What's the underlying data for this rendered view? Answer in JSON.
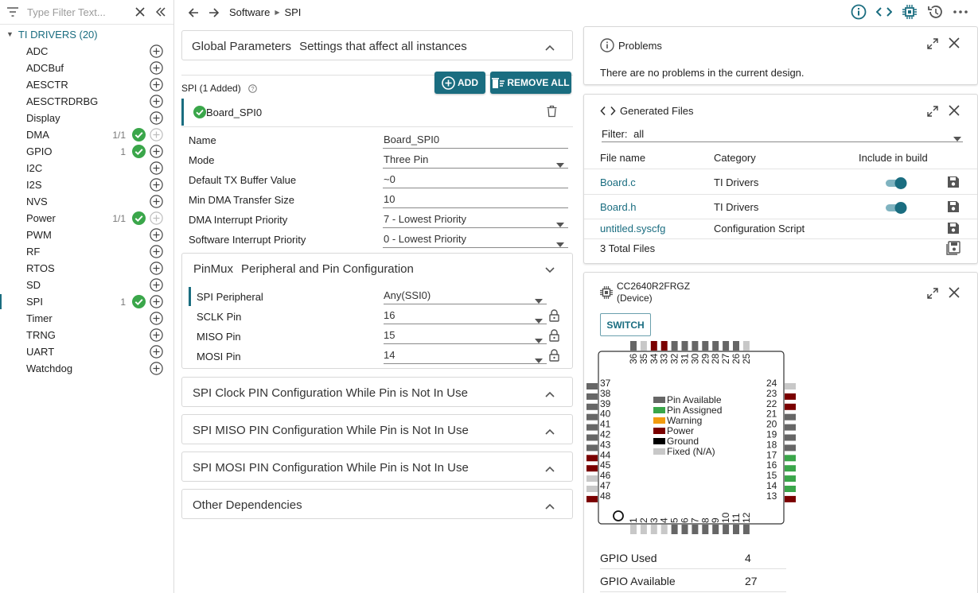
{
  "sidebar": {
    "filter_placeholder": "Type Filter Text...",
    "group_label": "TI DRIVERS (20)",
    "items": [
      {
        "label": "ADC",
        "count": "",
        "status": ""
      },
      {
        "label": "ADCBuf",
        "count": "",
        "status": ""
      },
      {
        "label": "AESCTR",
        "count": "",
        "status": ""
      },
      {
        "label": "AESCTRDRBG",
        "count": "",
        "status": ""
      },
      {
        "label": "Display",
        "count": "",
        "status": ""
      },
      {
        "label": "DMA",
        "count": "1/1",
        "status": "ok"
      },
      {
        "label": "GPIO",
        "count": "1",
        "status": "ok"
      },
      {
        "label": "I2C",
        "count": "",
        "status": ""
      },
      {
        "label": "I2S",
        "count": "",
        "status": ""
      },
      {
        "label": "NVS",
        "count": "",
        "status": ""
      },
      {
        "label": "Power",
        "count": "1/1",
        "status": "ok"
      },
      {
        "label": "PWM",
        "count": "",
        "status": ""
      },
      {
        "label": "RF",
        "count": "",
        "status": ""
      },
      {
        "label": "RTOS",
        "count": "",
        "status": ""
      },
      {
        "label": "SD",
        "count": "",
        "status": ""
      },
      {
        "label": "SPI",
        "count": "1",
        "status": "ok"
      },
      {
        "label": "Timer",
        "count": "",
        "status": ""
      },
      {
        "label": "TRNG",
        "count": "",
        "status": ""
      },
      {
        "label": "UART",
        "count": "",
        "status": ""
      },
      {
        "label": "Watchdog",
        "count": "",
        "status": ""
      }
    ]
  },
  "breadcrumb": {
    "root": "Software",
    "current": "SPI"
  },
  "global": {
    "title": "Global Parameters",
    "subtitle": "Settings that affect all instances"
  },
  "spi": {
    "header": "SPI (1 Added)",
    "add_label": "ADD",
    "remove_all_label": "REMOVE ALL",
    "instance_name": "Board_SPI0"
  },
  "fields": [
    {
      "label": "Name",
      "value": "Board_SPI0",
      "dropdown": false
    },
    {
      "label": "Mode",
      "value": "Three Pin",
      "dropdown": true
    },
    {
      "label": "Default TX Buffer Value",
      "value": "~0",
      "dropdown": false
    },
    {
      "label": "Min DMA Transfer Size",
      "value": "10",
      "dropdown": false
    },
    {
      "label": "DMA Interrupt Priority",
      "value": "7 - Lowest Priority",
      "dropdown": true
    },
    {
      "label": "Software Interrupt Priority",
      "value": "0 - Lowest Priority",
      "dropdown": true
    }
  ],
  "pinmux": {
    "title": "PinMux",
    "subtitle": "Peripheral and Pin Configuration",
    "rows": [
      {
        "label": "SPI Peripheral",
        "value": "Any(SSI0)",
        "lock": false
      },
      {
        "label": "SCLK Pin",
        "value": "16",
        "lock": true
      },
      {
        "label": "MISO Pin",
        "value": "15",
        "lock": true
      },
      {
        "label": "MOSI Pin",
        "value": "14",
        "lock": true
      }
    ]
  },
  "collapsed_sections": [
    "SPI Clock PIN Configuration While Pin is Not In Use",
    "SPI MISO PIN Configuration While Pin is Not In Use",
    "SPI MOSI PIN Configuration While Pin is Not In Use",
    "Other Dependencies"
  ],
  "problems": {
    "title": "Problems",
    "message": "There are no problems in the current design."
  },
  "generated": {
    "title": "Generated Files",
    "filter_label": "Filter:",
    "filter_value": "all",
    "columns": [
      "File name",
      "Category",
      "Include in build"
    ],
    "files": [
      {
        "name": "Board.c",
        "category": "TI Drivers",
        "include": true
      },
      {
        "name": "Board.h",
        "category": "TI Drivers",
        "include": true
      },
      {
        "name": "untitled.syscfg",
        "category": "Configuration Script",
        "include": null
      }
    ],
    "total": "3 Total Files"
  },
  "device": {
    "name_line1": "CC2640R2FRGZ",
    "name_line2": "(Device)",
    "switch_label": "SWITCH",
    "legend": [
      {
        "label": "Pin Available",
        "color": "#666666"
      },
      {
        "label": "Pin Assigned",
        "color": "#3aa64a"
      },
      {
        "label": "Warning",
        "color": "#f29b0f"
      },
      {
        "label": "Power",
        "color": "#7a0000"
      },
      {
        "label": "Ground",
        "color": "#000000"
      },
      {
        "label": "Fixed (N/A)",
        "color": "#c8c8c8"
      }
    ],
    "top_pins": [
      {
        "n": "36",
        "s": "avail"
      },
      {
        "n": "35",
        "s": "fixed"
      },
      {
        "n": "34",
        "s": "power"
      },
      {
        "n": "33",
        "s": "power"
      },
      {
        "n": "32",
        "s": "avail"
      },
      {
        "n": "31",
        "s": "avail"
      },
      {
        "n": "30",
        "s": "avail"
      },
      {
        "n": "29",
        "s": "avail"
      },
      {
        "n": "28",
        "s": "avail"
      },
      {
        "n": "27",
        "s": "avail"
      },
      {
        "n": "26",
        "s": "avail"
      },
      {
        "n": "25",
        "s": "fixed"
      }
    ],
    "left_pins": [
      {
        "n": "37",
        "s": "avail"
      },
      {
        "n": "38",
        "s": "avail"
      },
      {
        "n": "39",
        "s": "avail"
      },
      {
        "n": "40",
        "s": "avail"
      },
      {
        "n": "41",
        "s": "avail"
      },
      {
        "n": "42",
        "s": "avail"
      },
      {
        "n": "43",
        "s": "avail"
      },
      {
        "n": "44",
        "s": "power"
      },
      {
        "n": "45",
        "s": "power"
      },
      {
        "n": "46",
        "s": "fixed"
      },
      {
        "n": "47",
        "s": "fixed"
      },
      {
        "n": "48",
        "s": "power"
      }
    ],
    "right_pins": [
      {
        "n": "24",
        "s": "fixed"
      },
      {
        "n": "23",
        "s": "power"
      },
      {
        "n": "22",
        "s": "power"
      },
      {
        "n": "21",
        "s": "avail"
      },
      {
        "n": "20",
        "s": "avail"
      },
      {
        "n": "19",
        "s": "avail"
      },
      {
        "n": "18",
        "s": "avail"
      },
      {
        "n": "17",
        "s": "assigned"
      },
      {
        "n": "16",
        "s": "assigned"
      },
      {
        "n": "15",
        "s": "assigned"
      },
      {
        "n": "14",
        "s": "assigned"
      },
      {
        "n": "13",
        "s": "power"
      }
    ],
    "bottom_pins": [
      {
        "n": "1",
        "s": "fixed"
      },
      {
        "n": "2",
        "s": "fixed"
      },
      {
        "n": "3",
        "s": "fixed"
      },
      {
        "n": "4",
        "s": "fixed"
      },
      {
        "n": "5",
        "s": "avail"
      },
      {
        "n": "6",
        "s": "avail"
      },
      {
        "n": "7",
        "s": "avail"
      },
      {
        "n": "8",
        "s": "avail"
      },
      {
        "n": "9",
        "s": "avail"
      },
      {
        "n": "10",
        "s": "avail"
      },
      {
        "n": "11",
        "s": "avail"
      },
      {
        "n": "12",
        "s": "avail"
      }
    ],
    "gpio_used_label": "GPIO Used",
    "gpio_used": "4",
    "gpio_available_label": "GPIO Available",
    "gpio_available": "27"
  },
  "colors": {
    "accent": "#1a6d80",
    "ok": "#3aa64a",
    "icon": "#555555"
  }
}
